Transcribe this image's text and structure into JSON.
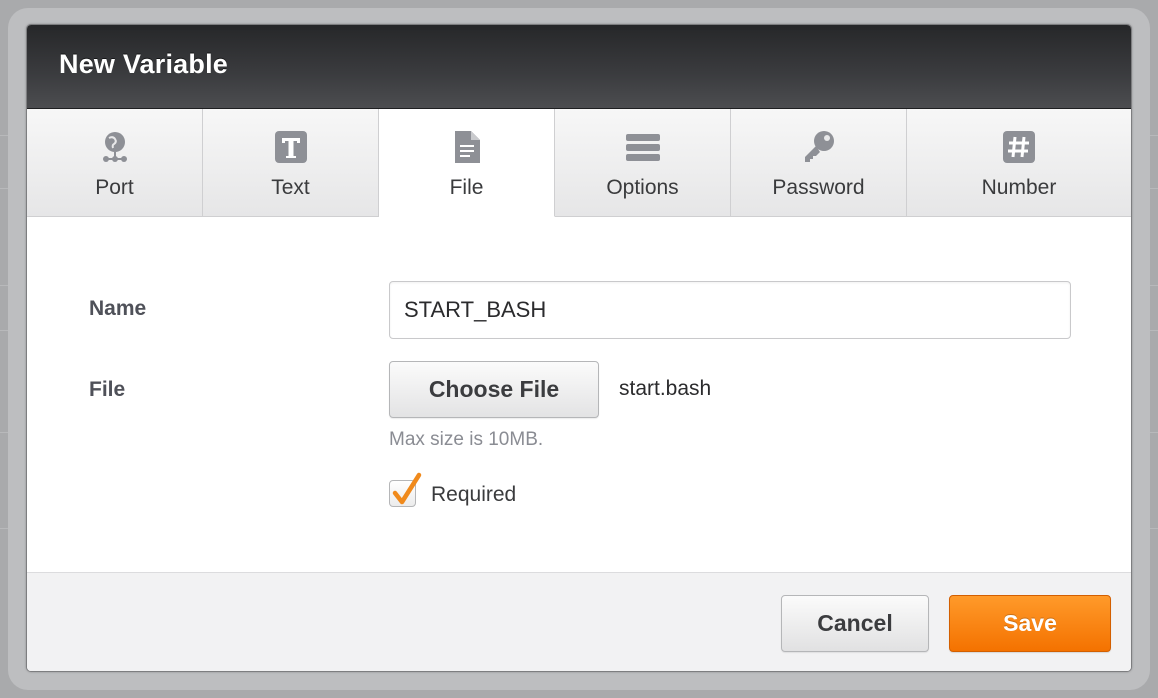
{
  "dialog": {
    "title": "New Variable"
  },
  "tabs": [
    {
      "label": "Port",
      "icon": "port-globe-icon",
      "active": false
    },
    {
      "label": "Text",
      "icon": "text-t-icon",
      "active": false
    },
    {
      "label": "File",
      "icon": "file-document-icon",
      "active": true
    },
    {
      "label": "Options",
      "icon": "options-list-icon",
      "active": false
    },
    {
      "label": "Password",
      "icon": "key-icon",
      "active": false
    },
    {
      "label": "Number",
      "icon": "hash-icon",
      "active": false
    }
  ],
  "form": {
    "name_label": "Name",
    "name_value": "START_BASH",
    "file_label": "File",
    "choose_file_label": "Choose File",
    "file_name": "start.bash",
    "max_size_hint": "Max size is 10MB.",
    "required_label": "Required",
    "required_checked": true
  },
  "footer": {
    "cancel_label": "Cancel",
    "save_label": "Save"
  },
  "colors": {
    "accent": "#f47200",
    "header_dark": "#2c2d30",
    "checkmark": "#f08a1c"
  }
}
